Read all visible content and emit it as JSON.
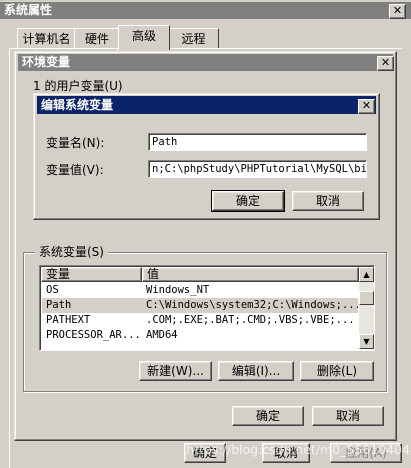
{
  "system_properties": {
    "title": "系统属性",
    "tabs": [
      "计算机名",
      "硬件",
      "高级",
      "远程"
    ],
    "ok_label": "确定",
    "cancel_label": "取消",
    "apply_label": "应用(A)"
  },
  "env_dialog": {
    "title": "环境变量",
    "user_group_partial": "1 的用户变量(U)",
    "system_group": "系统变量(S)",
    "columns": [
      "变量",
      "值"
    ],
    "rows": [
      {
        "name": "OS",
        "value": "Windows_NT"
      },
      {
        "name": "Path",
        "value": "C:\\Windows\\system32;C:\\Windows;..."
      },
      {
        "name": "PATHEXT",
        "value": ".COM;.EXE;.BAT;.CMD;.VBS;.VBE;..."
      },
      {
        "name": "PROCESSOR_AR...",
        "value": "AMD64"
      }
    ],
    "new_label": "新建(W)...",
    "edit_label": "编辑(I)...",
    "delete_label": "删除(L)",
    "ok_label": "确定",
    "cancel_label": "取消"
  },
  "edit_dialog": {
    "title": "编辑系统变量",
    "name_label": "变量名(N):",
    "value_label": "变量值(V):",
    "name_value": "Path",
    "value_value": "n;C:\\phpStudy\\PHPTutorial\\MySQL\\bin",
    "ok_label": "确定",
    "cancel_label": "取消"
  },
  "watermark": "https://blog.csdn.net/m0_55610404",
  "colors": {
    "active_title": "#0a246a",
    "inactive_title": "#808080",
    "selection": "#d4d0c8",
    "face": "#d4d0c8"
  }
}
